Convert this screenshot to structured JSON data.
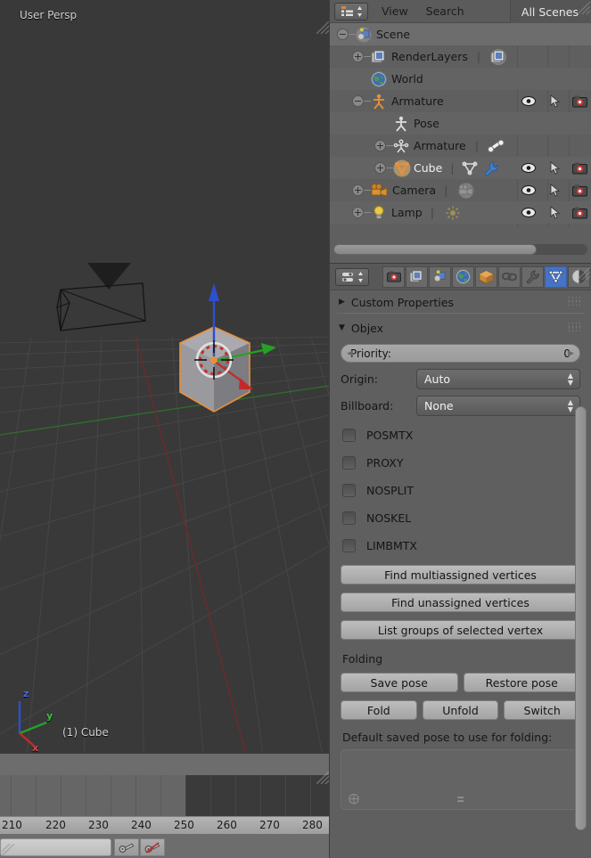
{
  "app": "Blender",
  "viewport": {
    "header_text": "User Persp",
    "object_name": "(1) Cube",
    "axis_gizmo": {
      "z": "z",
      "y": "y",
      "x": "x"
    },
    "objects": [
      {
        "name": "Camera",
        "type": "camera",
        "selected": false
      },
      {
        "name": "Cube",
        "type": "mesh",
        "selected": true
      }
    ],
    "colors": {
      "bg": "#393939",
      "selected_outline": "#e8913c",
      "axis_x": "#c03030",
      "axis_y": "#3eae3e",
      "axis_z": "#3a5ad8"
    }
  },
  "outliner": {
    "display_mode_icon": "outliner-display-mode-icon",
    "menus": [
      "View",
      "Search"
    ],
    "scene_filter": "All Scenes",
    "column_icons": [
      "eye-icon",
      "cursor-icon",
      "camera-icon"
    ],
    "rows": [
      {
        "label": "Scene",
        "indent": 0,
        "icon": "scene-icon",
        "expander": "collapse",
        "selected": true,
        "white": false,
        "restrict": false,
        "extra_icons": []
      },
      {
        "label": "RenderLayers",
        "indent": 1,
        "icon": "renderlayers-icon",
        "expander": "expand",
        "selected": false,
        "white": false,
        "restrict": false,
        "extra_icons": [
          "renderlayers-data-icon"
        ]
      },
      {
        "label": "World",
        "indent": 1,
        "icon": "world-icon",
        "expander": "none",
        "selected": false,
        "white": false,
        "restrict": false,
        "extra_icons": []
      },
      {
        "label": "Armature",
        "indent": 1,
        "icon": "armature-icon",
        "expander": "collapse",
        "selected": false,
        "white": false,
        "restrict": true,
        "extra_icons": []
      },
      {
        "label": "Pose",
        "indent": 2,
        "icon": "pose-icon",
        "expander": "none",
        "selected": false,
        "white": false,
        "restrict": false,
        "extra_icons": []
      },
      {
        "label": "Armature",
        "indent": 2,
        "icon": "armature-data-icon",
        "expander": "expand",
        "selected": false,
        "white": false,
        "restrict": false,
        "extra_icons": [
          "bone-icon"
        ]
      },
      {
        "label": "Cube",
        "indent": 2,
        "icon": "mesh-object-icon",
        "expander": "expand",
        "selected": false,
        "white": true,
        "restrict": true,
        "extra_icons": [
          "mesh-data-icon",
          "wrench-icon"
        ]
      },
      {
        "label": "Camera",
        "indent": 1,
        "icon": "camera-obj-icon",
        "expander": "expand",
        "selected": false,
        "white": false,
        "restrict": true,
        "extra_icons": [
          "camera-data-icon"
        ]
      },
      {
        "label": "Lamp",
        "indent": 1,
        "icon": "lamp-icon",
        "expander": "expand",
        "selected": false,
        "white": false,
        "restrict": true,
        "extra_icons": [
          "lamp-data-icon"
        ]
      }
    ]
  },
  "properties": {
    "tabs": [
      {
        "name": "render",
        "icon": "render-camera-icon",
        "active": false
      },
      {
        "name": "render-layers",
        "icon": "render-layers-icon",
        "active": false
      },
      {
        "name": "scene",
        "icon": "scene-icon",
        "active": false
      },
      {
        "name": "world",
        "icon": "world-icon",
        "active": false
      },
      {
        "name": "object",
        "icon": "object-cube-icon",
        "active": false
      },
      {
        "name": "constraints",
        "icon": "chain-link-icon",
        "active": false
      },
      {
        "name": "modifiers",
        "icon": "wrench-icon",
        "active": false
      },
      {
        "name": "object-data",
        "icon": "mesh-data-icon",
        "active": true
      },
      {
        "name": "material",
        "icon": "material-sphere-icon",
        "active": false
      }
    ],
    "panels": [
      {
        "title": "Custom Properties",
        "open": false
      },
      {
        "title": "Objex",
        "open": true
      }
    ],
    "priority": {
      "label": "Priority:",
      "value": "0"
    },
    "selects": [
      {
        "label": "Origin:",
        "value": "Auto"
      },
      {
        "label": "Billboard:",
        "value": "None"
      }
    ],
    "checkboxes": [
      {
        "label": "POSMTX",
        "checked": false
      },
      {
        "label": "PROXY",
        "checked": false
      },
      {
        "label": "NOSPLIT",
        "checked": false
      },
      {
        "label": "NOSKEL",
        "checked": false
      },
      {
        "label": "LIMBMTX",
        "checked": false
      }
    ],
    "vertex_buttons": [
      "Find multiassigned vertices",
      "Find unassigned vertices",
      "List groups of selected vertex"
    ],
    "folding": {
      "section_label": "Folding",
      "row1": [
        "Save pose",
        "Restore pose"
      ],
      "row2": [
        "Fold",
        "Unfold",
        "Switch"
      ],
      "pose_label": "Default saved pose to use for folding:"
    }
  },
  "timeline": {
    "frame_numbers": [
      "210",
      "220",
      "230",
      "240",
      "250",
      "260",
      "270",
      "280"
    ],
    "playback_end_frame": "250",
    "current_frame_field": "",
    "buttons": [
      "insert-keyframe-icon",
      "delete-keyframe-icon"
    ]
  }
}
